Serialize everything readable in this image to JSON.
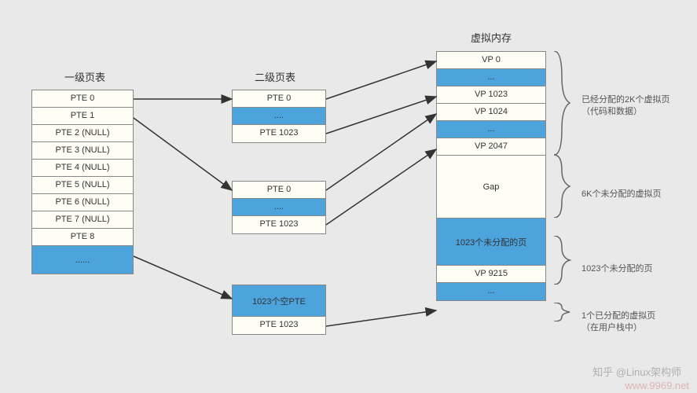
{
  "titles": {
    "l1": "一级页表",
    "l2": "二级页表",
    "vm": "虚拟内存"
  },
  "l1_table": {
    "rows": [
      "PTE 0",
      "PTE 1",
      "PTE 2 (NULL)",
      "PTE 3 (NULL)",
      "PTE 4 (NULL)",
      "PTE 5 (NULL)",
      "PTE 6 (NULL)",
      "PTE 7 (NULL)",
      "PTE 8"
    ],
    "tail": "......"
  },
  "l2_table_a": {
    "rows": [
      "PTE 0",
      "....",
      "PTE 1023"
    ]
  },
  "l2_table_b": {
    "rows": [
      "PTE 0",
      "....",
      "PTE 1023"
    ]
  },
  "l2_table_c": {
    "rows": [
      "1023个空PTE",
      "PTE 1023"
    ]
  },
  "vm_table": {
    "rows": [
      {
        "text": "VP 0",
        "cls": "cream"
      },
      {
        "text": "...",
        "cls": "blue"
      },
      {
        "text": "VP 1023",
        "cls": "cream"
      },
      {
        "text": "VP 1024",
        "cls": "cream"
      },
      {
        "text": "...",
        "cls": "blue"
      },
      {
        "text": "VP 2047",
        "cls": "cream"
      },
      {
        "text": "Gap",
        "cls": "cream gap-cell"
      },
      {
        "text": "1023个未分配的页",
        "cls": "blue unalloc-cell"
      },
      {
        "text": "VP 9215",
        "cls": "cream"
      },
      {
        "text": "...",
        "cls": "blue"
      }
    ]
  },
  "side_labels": {
    "allocated_2k_l1": "已经分配的2K个虚拟页",
    "allocated_2k_l2": "（代码和数据）",
    "unalloc_6k": "6K个未分配的虚拟页",
    "unalloc_1023": "1023个未分配的页",
    "alloc_1_l1": "1个已分配的虚拟页",
    "alloc_1_l2": "（在用户栈中）"
  },
  "watermarks": {
    "w1": "知乎 @Linux架构师",
    "w2": "www.9969.net"
  }
}
